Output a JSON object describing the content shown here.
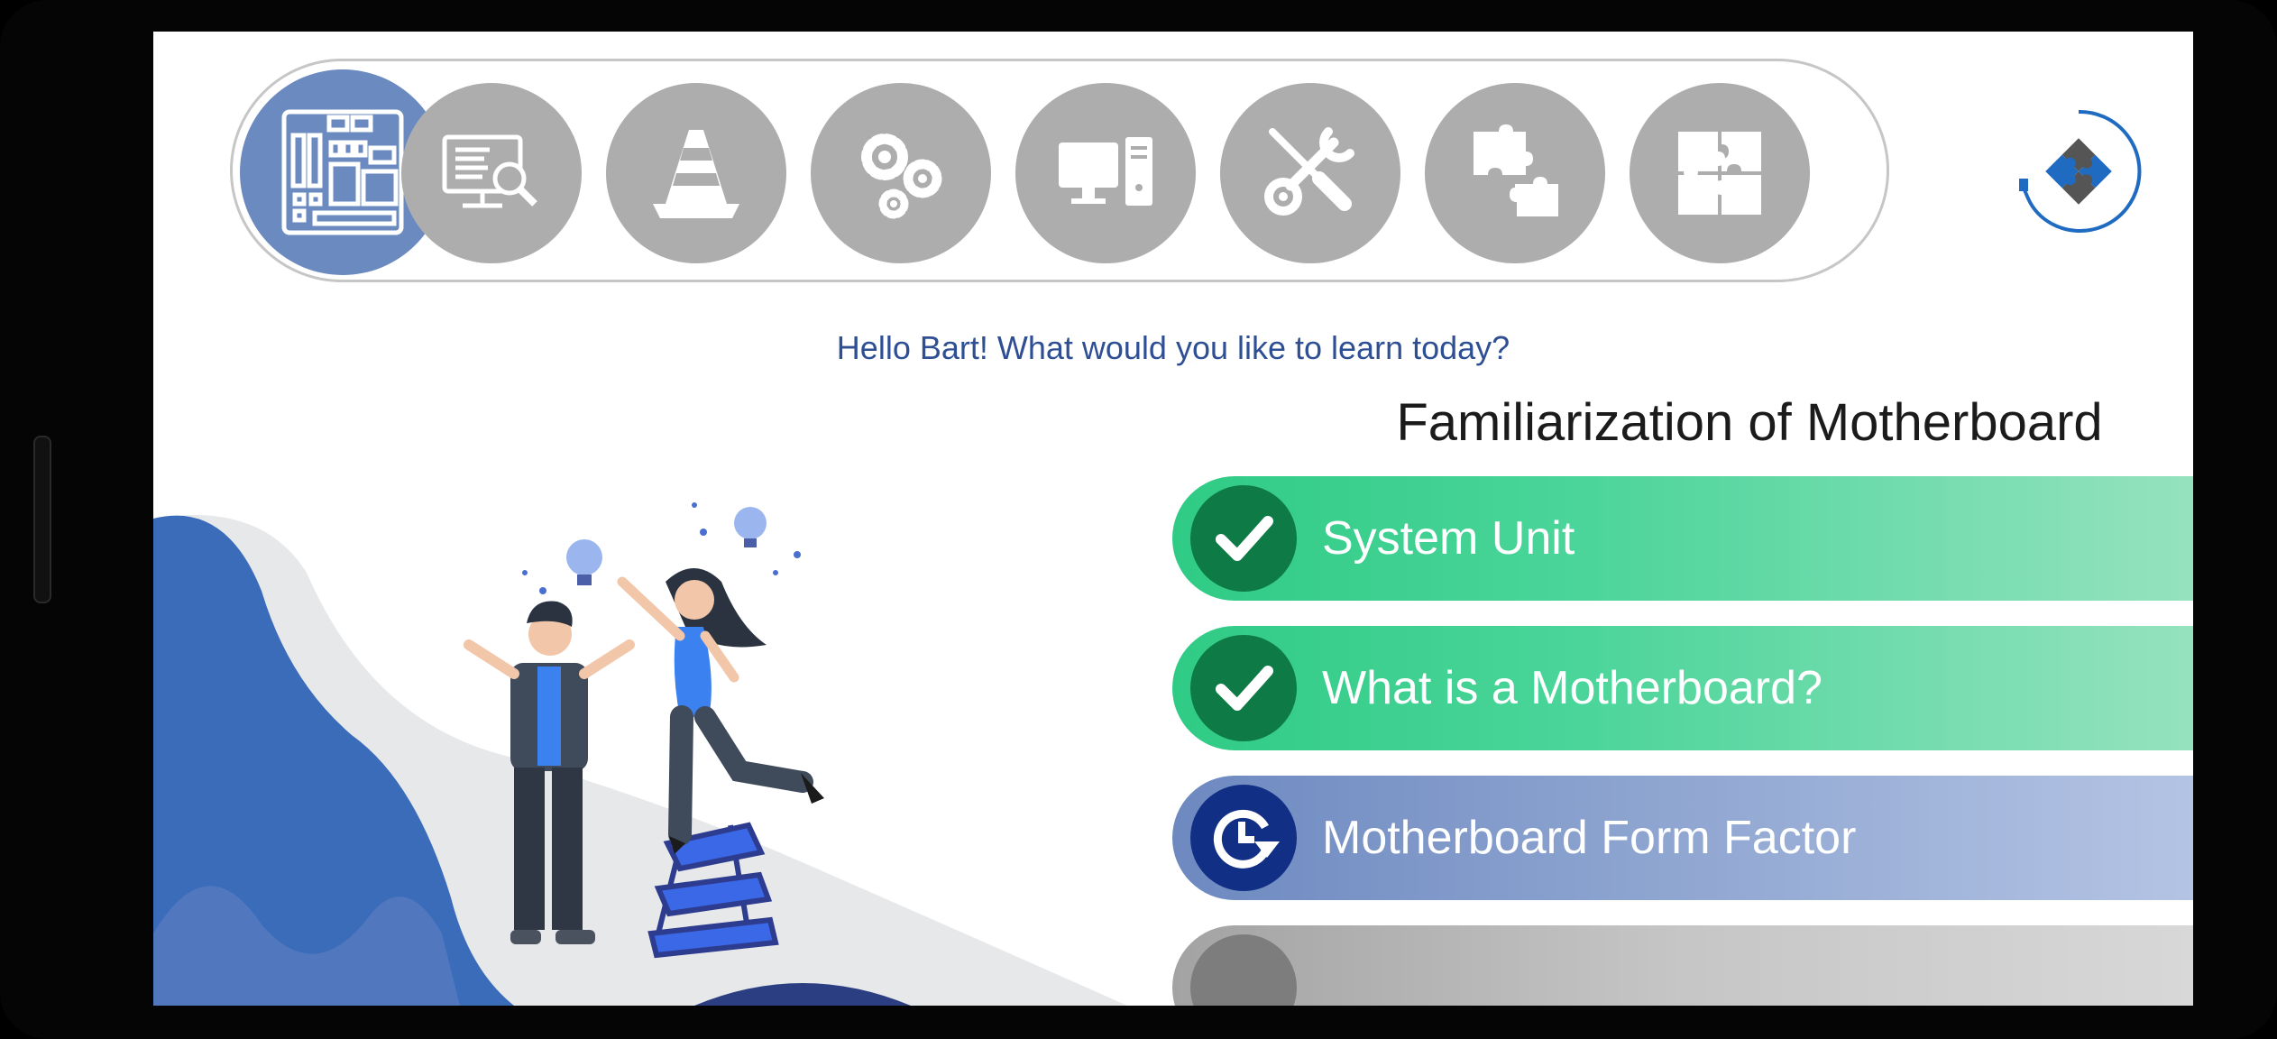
{
  "nav": {
    "items": [
      {
        "icon": "motherboard-icon",
        "active": true
      },
      {
        "icon": "monitor-magnifier-icon",
        "active": false
      },
      {
        "icon": "traffic-cone-icon",
        "active": false
      },
      {
        "icon": "gears-icon",
        "active": false
      },
      {
        "icon": "desktop-computer-icon",
        "active": false
      },
      {
        "icon": "screwdriver-wrench-icon",
        "active": false
      },
      {
        "icon": "puzzle-pieces-icon",
        "active": false
      },
      {
        "icon": "puzzle-complete-icon",
        "active": false
      }
    ]
  },
  "app": {
    "logo_icon": "puzzle-cable-logo-icon"
  },
  "greeting": "Hello Bart! What would you like to learn today?",
  "lesson": {
    "title": "Familiarization of Motherboard",
    "topics": [
      {
        "label": "System Unit",
        "status": "completed",
        "icon": "check-icon"
      },
      {
        "label": "What is a Motherboard?",
        "status": "completed",
        "icon": "check-icon"
      },
      {
        "label": "Motherboard Form Factor",
        "status": "in-progress",
        "icon": "clock-refresh-icon"
      },
      {
        "label": "",
        "status": "locked",
        "icon": "locked-icon"
      }
    ]
  },
  "colors": {
    "accent_blue": "#6a8ac0",
    "completed_green": "#2fcb85",
    "in_progress_blue": "#122f86",
    "inactive_gray": "#adadad",
    "greeting_text": "#2f4f94"
  }
}
